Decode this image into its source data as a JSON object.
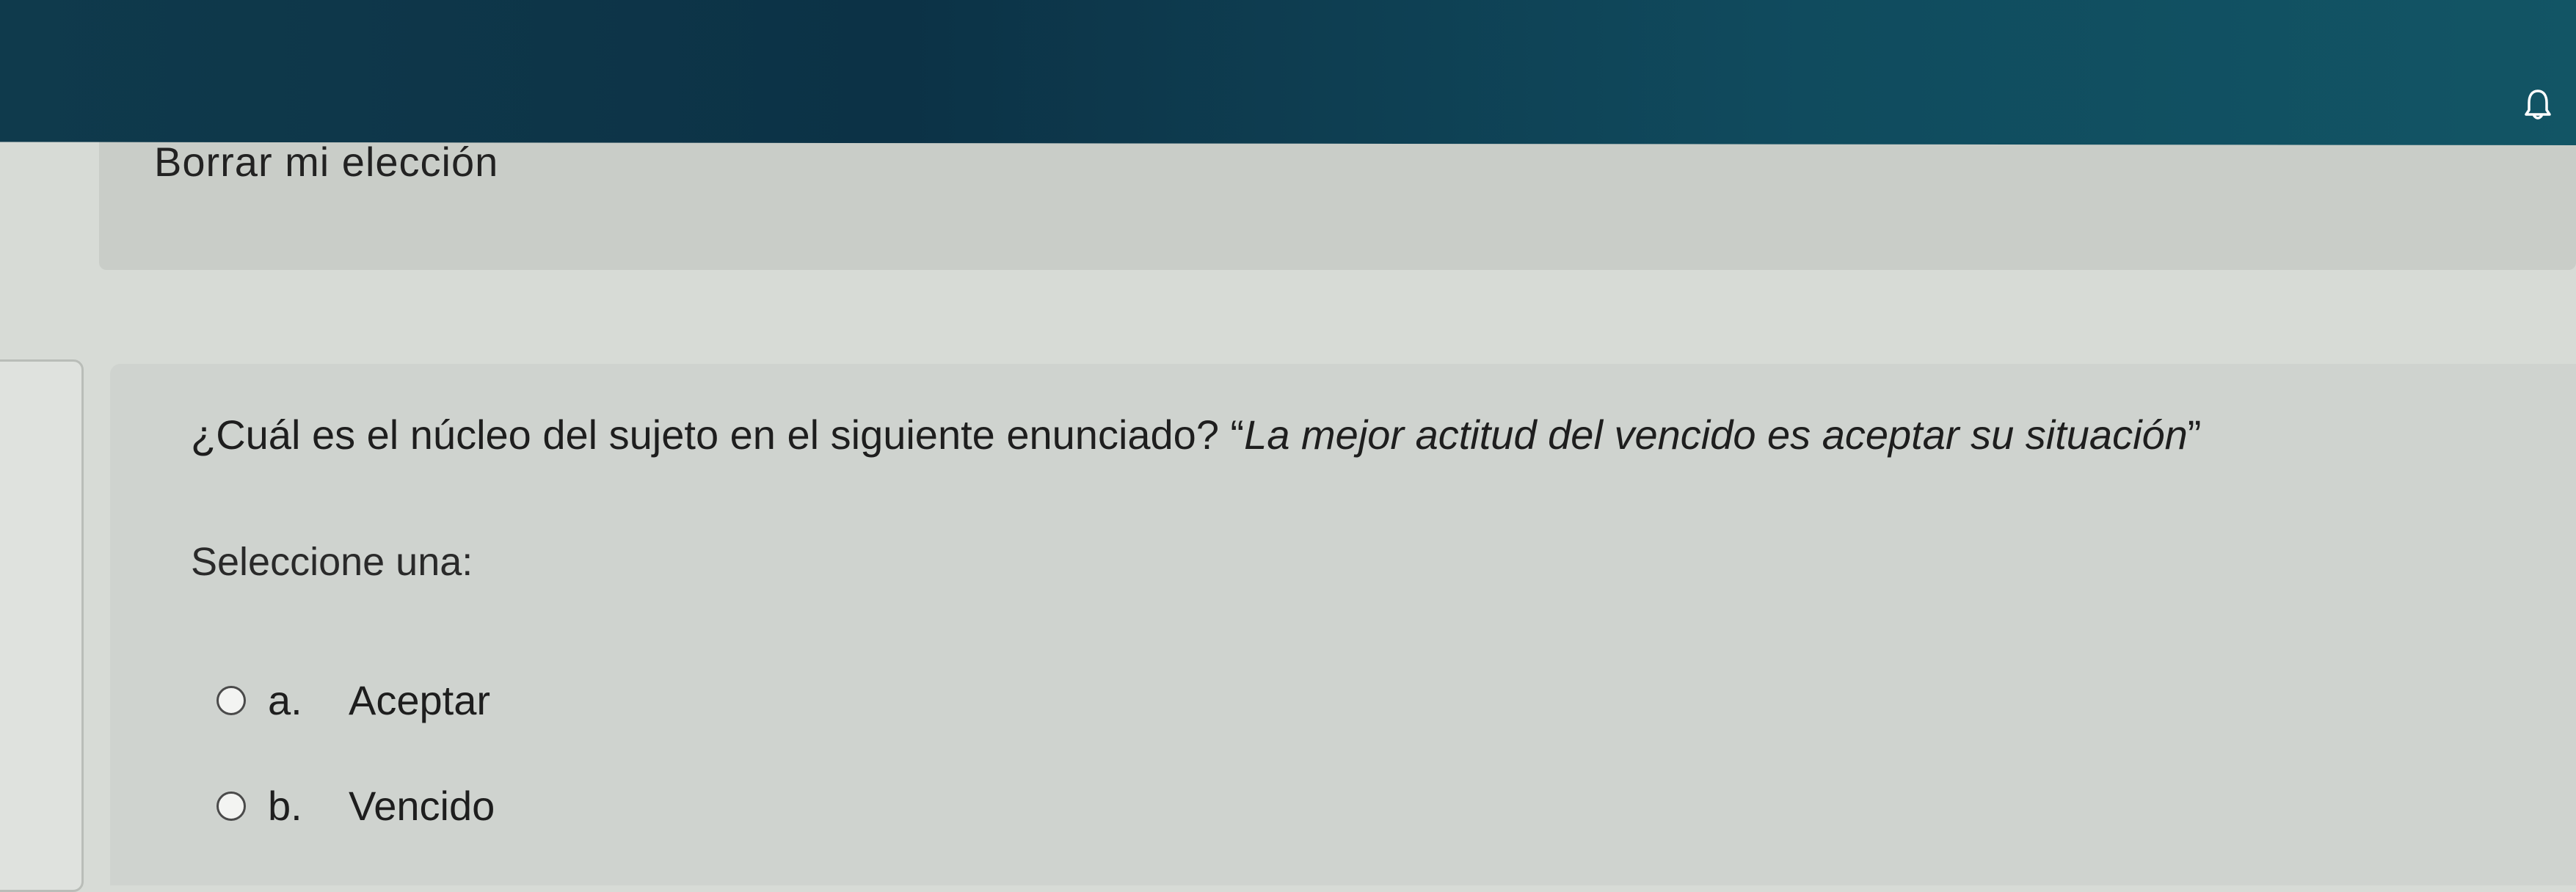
{
  "header": {
    "icons": [
      "bell-icon"
    ],
    "color": "#0c3246"
  },
  "previous_question": {
    "clear_choice_label": "Borrar mi elección"
  },
  "question": {
    "text_plain": "¿Cuál es el núcleo del sujeto en el siguiente enunciado? “",
    "text_italic": "La mejor actitud del vencido es aceptar su situación",
    "text_close": "”",
    "prompt": "Seleccione una:",
    "options": [
      {
        "letter": "a.",
        "label": "Aceptar",
        "selected": false
      },
      {
        "letter": "b.",
        "label": "Vencido",
        "selected": false
      }
    ]
  },
  "side_panel": {
    "glyph_top": ")",
    "glyph_bottom": "|"
  }
}
